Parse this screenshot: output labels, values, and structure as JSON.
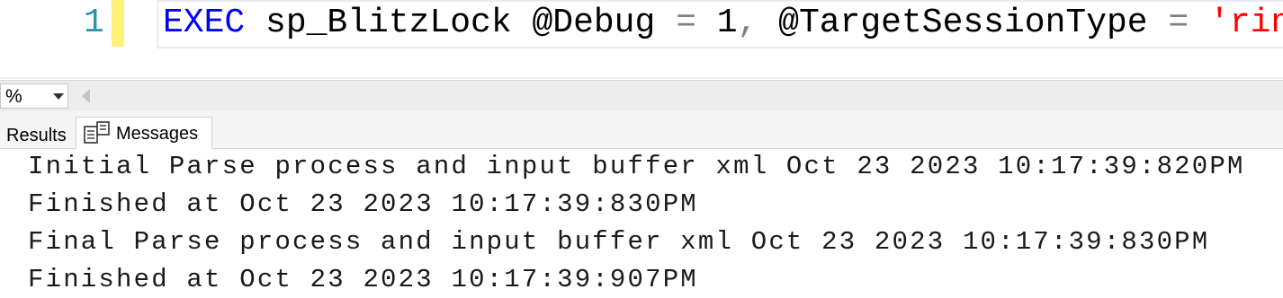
{
  "editor": {
    "line_number": "1",
    "code": {
      "kw_exec": "EXEC",
      "proc": " sp_BlitzLock @Debug ",
      "eq1": "=",
      "val1": " 1",
      "comma": ",",
      "param2": " @TargetSessionType ",
      "eq2": "=",
      "space": " ",
      "str": "'ring'"
    }
  },
  "zoom": {
    "value": "%"
  },
  "tabs": [
    {
      "label": "Results"
    },
    {
      "label": "Messages"
    }
  ],
  "messages": [
    "Initial Parse process and input buffer xml Oct 23 2023 10:17:39:820PM",
    "Finished at Oct 23 2023 10:17:39:830PM",
    "Final Parse process and input buffer xml Oct 23 2023 10:17:39:830PM",
    "Finished at Oct 23 2023 10:17:39:907PM"
  ],
  "icons": {
    "messages_tab": "messages-icon",
    "zoom_dropdown": "chevron-down-icon",
    "scroll_left": "scroll-left-icon"
  }
}
